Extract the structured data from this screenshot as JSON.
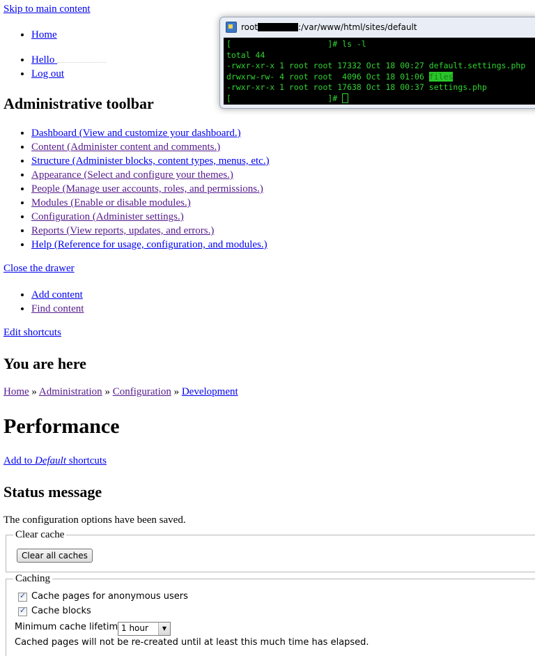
{
  "skip_link": "Skip to main content",
  "user_menu": {
    "home": "Home",
    "hello": "Hello",
    "logout": "Log out"
  },
  "terminal": {
    "title_prefix": "root",
    "title_path": ":/var/www/html/sites/default",
    "lines": {
      "prompt1": "[                    ]# ls -l",
      "total": "total 44",
      "row1_meta": "-rwxr-xr-x 1 root root 17332 Oct 18 00:27 ",
      "row1_file": "default.settings.php",
      "row2_meta": "drwxrw-rw- 4 root root  4096 Oct 18 01:06 ",
      "row2_file": "files",
      "row3_meta": "-rwxr-xr-x 1 root root 17638 Oct 18 00:37 ",
      "row3_file": "settings.php",
      "prompt2": "[                    ]# "
    }
  },
  "admin_toolbar": {
    "heading": "Administrative toolbar",
    "items": [
      {
        "label": "Dashboard (View and customize your dashboard.)",
        "visited": false
      },
      {
        "label": "Content (Administer content and comments.)",
        "visited": true
      },
      {
        "label": "Structure (Administer blocks, content types, menus, etc.)",
        "visited": false
      },
      {
        "label": "Appearance (Select and configure your themes.)",
        "visited": true
      },
      {
        "label": "People (Manage user accounts, roles, and permissions.)",
        "visited": true
      },
      {
        "label": "Modules (Enable or disable modules.)",
        "visited": true
      },
      {
        "label": "Configuration (Administer settings.)",
        "visited": true
      },
      {
        "label": "Reports (View reports, updates, and errors.)",
        "visited": true
      },
      {
        "label": "Help (Reference for usage, configuration, and modules.)",
        "visited": false
      }
    ],
    "close_drawer": "Close the drawer",
    "shortcuts": [
      "Add content",
      "Find content"
    ],
    "edit_shortcuts": "Edit shortcuts"
  },
  "breadcrumb": {
    "heading": "You are here",
    "items": [
      "Home",
      "Administration",
      "Configuration",
      "Development"
    ],
    "separator": "»"
  },
  "page_title": "Performance",
  "add_shortcut": {
    "prefix": "Add to ",
    "set_name": "Default",
    "suffix": " shortcuts"
  },
  "status": {
    "heading": "Status message",
    "text": "The configuration options have been saved."
  },
  "clear_cache": {
    "legend": "Clear cache",
    "button": "Clear all caches"
  },
  "caching": {
    "legend": "Caching",
    "cache_anon": "Cache pages for anonymous users",
    "cache_blocks": "Cache blocks",
    "min_lifetime_label": "Minimum cache lifetime",
    "min_lifetime_value": "1 hour",
    "description": "Cached pages will not be re-created until at least this much time has elapsed."
  }
}
